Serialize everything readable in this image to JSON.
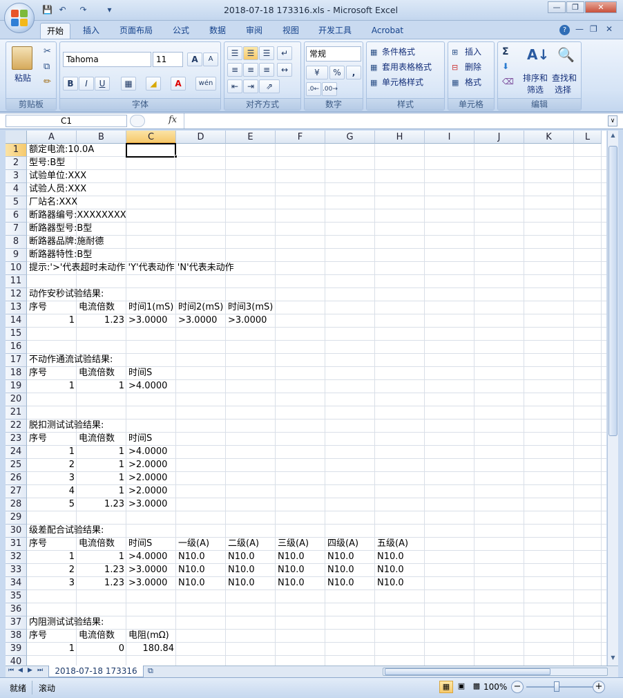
{
  "window": {
    "title": "2018-07-18 173316.xls - Microsoft Excel",
    "office_btn_icon": "office-logo-icon"
  },
  "qat": [
    "save-icon",
    "undo-icon",
    "redo-icon",
    "customize-icon"
  ],
  "tabs": [
    "开始",
    "插入",
    "页面布局",
    "公式",
    "数据",
    "审阅",
    "视图",
    "开发工具",
    "Acrobat"
  ],
  "ribbon": {
    "clipboard": {
      "paste": "粘贴",
      "label": "剪贴板"
    },
    "font": {
      "name": "Tahoma",
      "size": "11",
      "label": "字体",
      "bold": "B",
      "italic": "I",
      "underline": "U",
      "grow": "A",
      "shrink": "A",
      "phonetic": "wén"
    },
    "align": {
      "label": "对齐方式"
    },
    "number": {
      "format": "常规",
      "label": "数字",
      "percent": "%",
      "comma": ","
    },
    "styles": {
      "cond": "条件格式",
      "table": "套用表格格式",
      "cell": "单元格样式",
      "label": "样式"
    },
    "cells": {
      "insert": "插入",
      "delete": "删除",
      "format": "格式",
      "label": "单元格"
    },
    "editing": {
      "sort": "排序和\n筛选",
      "sort1": "排序和",
      "sort2": "筛选",
      "find1": "查找和",
      "find2": "选择",
      "label": "编辑",
      "sum": "Σ"
    }
  },
  "formula_bar": {
    "name_box": "C1",
    "fx": "fx",
    "value": ""
  },
  "columns": [
    "A",
    "B",
    "C",
    "D",
    "E",
    "F",
    "G",
    "H",
    "I",
    "J",
    "K",
    "L"
  ],
  "rows": [
    "1",
    "2",
    "3",
    "4",
    "5",
    "6",
    "7",
    "8",
    "9",
    "10",
    "11",
    "12",
    "13",
    "14",
    "15",
    "16",
    "17",
    "18",
    "19",
    "20",
    "21",
    "22",
    "23",
    "24",
    "25",
    "26",
    "27",
    "28",
    "29",
    "30",
    "31",
    "32",
    "33",
    "34",
    "35",
    "36",
    "37",
    "38",
    "39",
    "40"
  ],
  "cells": {
    "r1": {
      "A": "额定电流:10.0A"
    },
    "r2": {
      "A": "型号:B型"
    },
    "r3": {
      "A": "试验单位:XXX"
    },
    "r4": {
      "A": "试验人员:XXX"
    },
    "r5": {
      "A": "厂站名:XXX"
    },
    "r6": {
      "A": "断路器编号:XXXXXXXX"
    },
    "r7": {
      "A": "断路器型号:B型"
    },
    "r8": {
      "A": "断路器品牌:施耐德"
    },
    "r9": {
      "A": "断路器特性:B型"
    },
    "r10": {
      "A": "提示:'>'代表超时未动作    'Y'代表动作   'N'代表未动作"
    },
    "r12": {
      "A": "动作安秒试验结果:"
    },
    "r13": {
      "A": "序号",
      "B": "电流倍数",
      "C": "时间1(mS)",
      "D": "时间2(mS)",
      "E": "时间3(mS)"
    },
    "r14": {
      "A": "1",
      "B": "1.23",
      "C": ">3.0000",
      "D": ">3.0000",
      "E": ">3.0000"
    },
    "r17": {
      "A": "不动作通流试验结果:"
    },
    "r18": {
      "A": "序号",
      "B": "电流倍数",
      "C": "时间S"
    },
    "r19": {
      "A": "1",
      "B": "1",
      "C": ">4.0000"
    },
    "r22": {
      "A": "脱扣测试试验结果:"
    },
    "r23": {
      "A": "序号",
      "B": "电流倍数",
      "C": "时间S"
    },
    "r24": {
      "A": "1",
      "B": "1",
      "C": ">4.0000"
    },
    "r25": {
      "A": "2",
      "B": "1",
      "C": ">2.0000"
    },
    "r26": {
      "A": "3",
      "B": "1",
      "C": ">2.0000"
    },
    "r27": {
      "A": "4",
      "B": "1",
      "C": ">2.0000"
    },
    "r28": {
      "A": "5",
      "B": "1.23",
      "C": ">3.0000"
    },
    "r30": {
      "A": "级差配合试验结果:"
    },
    "r31": {
      "A": "序号",
      "B": "电流倍数",
      "C": "时间S",
      "D": "一级(A)",
      "E": "二级(A)",
      "F": "三级(A)",
      "G": "四级(A)",
      "H": "五级(A)"
    },
    "r32": {
      "A": "1",
      "B": "1",
      "C": ">4.0000",
      "D": "N10.0",
      "E": "N10.0",
      "F": "N10.0",
      "G": "N10.0",
      "H": "N10.0"
    },
    "r33": {
      "A": "2",
      "B": "1.23",
      "C": ">3.0000",
      "D": "N10.0",
      "E": "N10.0",
      "F": "N10.0",
      "G": "N10.0",
      "H": "N10.0"
    },
    "r34": {
      "A": "3",
      "B": "1.23",
      "C": ">3.0000",
      "D": "N10.0",
      "E": "N10.0",
      "F": "N10.0",
      "G": "N10.0",
      "H": "N10.0"
    },
    "r37": {
      "A": "内阻测试试验结果:"
    },
    "r38": {
      "A": "序号",
      "B": "电流倍数",
      "C": "电阻(mΩ)"
    },
    "r39": {
      "A": "1",
      "B": "0",
      "C": "180.84"
    }
  },
  "numeric_cells": [
    "14A",
    "14B",
    "19A",
    "19B",
    "24A",
    "24B",
    "25A",
    "25B",
    "26A",
    "26B",
    "27A",
    "27B",
    "28A",
    "28B",
    "32A",
    "32B",
    "33A",
    "33B",
    "34A",
    "34B",
    "39A",
    "39B",
    "39C"
  ],
  "sheet_tab": "2018-07-18 173316",
  "status": {
    "ready": "就绪",
    "scroll": "滚动",
    "zoom": "100%"
  },
  "colors": {
    "accent": "#f6c96c",
    "grid": "#d9dfe8",
    "header_bg": "#dde7f3"
  }
}
